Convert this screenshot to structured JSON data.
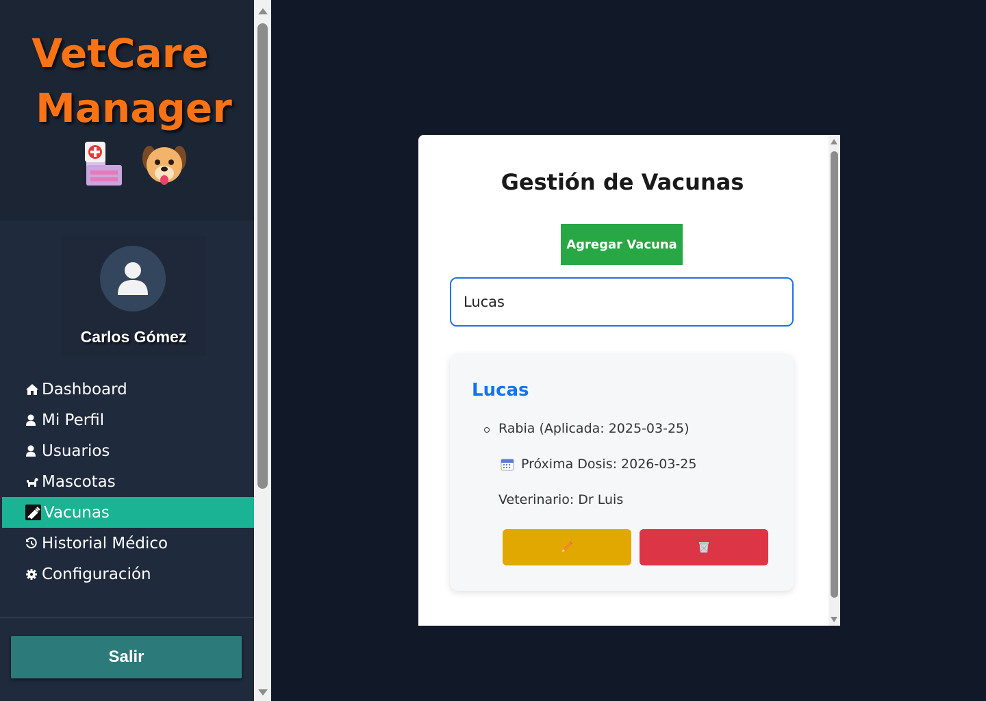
{
  "sidebar": {
    "logo_line1": "VetCare",
    "logo_line2": "Manager",
    "logo_icons": [
      "hospital-icon",
      "dog-icon"
    ],
    "user": {
      "name": "Carlos Gómez",
      "avatar_icon": "user-icon"
    },
    "nav": [
      {
        "label": "Dashboard",
        "icon": "home-icon",
        "active": false
      },
      {
        "label": "Mi Perfil",
        "icon": "user-icon",
        "active": false
      },
      {
        "label": "Usuarios",
        "icon": "user-icon",
        "active": false
      },
      {
        "label": "Mascotas",
        "icon": "dog-icon",
        "active": false
      },
      {
        "label": "Vacunas",
        "icon": "syringe-icon",
        "active": true
      },
      {
        "label": "Historial Médico",
        "icon": "history-icon",
        "active": false
      },
      {
        "label": "Configuración",
        "icon": "gear-icon",
        "active": false
      }
    ],
    "logout_label": "Salir"
  },
  "modal": {
    "title": "Gestión de Vacunas",
    "add_button": "Agregar Vacuna",
    "search_value": "Lucas",
    "card": {
      "pet_name": "Lucas",
      "vaccine_line": "Rabia (Aplicada: 2025-03-25)",
      "next_dose": "Próxima Dosis: 2026-03-25",
      "vet": "Veterinario: Dr Luis",
      "edit_icon": "pencil-icon",
      "delete_icon": "trash-icon"
    }
  },
  "colors": {
    "background": "#111827",
    "sidebar": "#1f2a3c",
    "logo_orange": "#f97316",
    "active_nav": "#1ab394",
    "logout": "#2d7a7a",
    "add_button": "#28a745",
    "search_border": "#1a73e8",
    "pet_name": "#1173f0",
    "edit_button": "#e0a800",
    "delete_button": "#dc3545"
  }
}
